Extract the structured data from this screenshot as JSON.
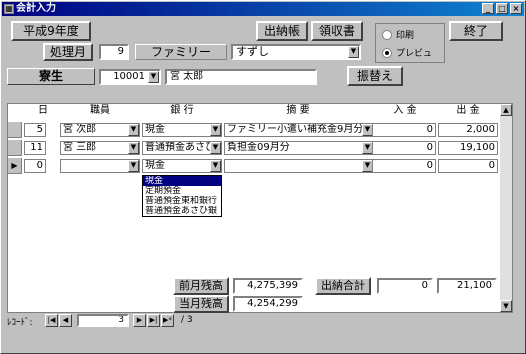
{
  "window": {
    "title": "会計入力"
  },
  "header": {
    "era_button": "平成9年度",
    "month_label": "処理月",
    "month_value": "9",
    "family_label": "ファミリー",
    "family_value": "すずし",
    "dorm_label": "寮生",
    "student_id": "10001",
    "student_name": "宮 太郎",
    "ledger_button": "出納帳",
    "receipt_button": "領収書",
    "print_radio": "印刷",
    "preview_radio": "プレビュ",
    "exit_button": "終了",
    "transfer_button": "振替え"
  },
  "grid": {
    "columns": [
      "日",
      "職員",
      "銀 行",
      "摘 要",
      "入 金",
      "出 金"
    ],
    "rows": [
      {
        "day": "5",
        "staff": "宮 次郎",
        "bank": "現金",
        "desc": "ファミリー小遣い補充金9月分",
        "income": "0",
        "expense": "2,000"
      },
      {
        "day": "11",
        "staff": "宮 三郎",
        "bank": "普通預金あさひ",
        "desc": "負担金09月分",
        "income": "0",
        "expense": "19,100"
      },
      {
        "day": "0",
        "staff": "",
        "bank": "現金",
        "desc": "",
        "income": "0",
        "expense": "0"
      }
    ],
    "dropdown_options": [
      "現金",
      "定期預金",
      "普通預金東和銀行",
      "普通預金あさひ銀"
    ]
  },
  "totals": {
    "prev_balance_label": "前月残高",
    "prev_balance": "4,275,399",
    "current_balance_label": "当月残高",
    "current_balance": "4,254,299",
    "sum_label": "出納合計",
    "sum_income": "0",
    "sum_expense": "21,100"
  },
  "record_nav": {
    "label": "ﾚｺｰﾄﾞ:",
    "current": "3",
    "total_text": "/ 3"
  }
}
